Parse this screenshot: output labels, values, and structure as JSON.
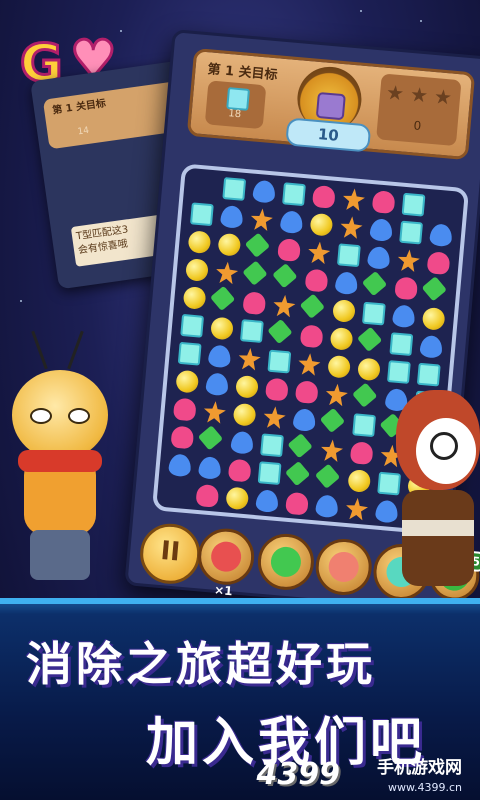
{
  "hud": {
    "level_label": "第 1 关目标",
    "target_count": "18",
    "moves": "10",
    "score": "0"
  },
  "back_card": {
    "level_label": "第 1 关目标",
    "target_count": "14",
    "note": "T型匹配这3\n会有惊喜哦"
  },
  "boosters": {
    "pause_icon": "II",
    "hammer_count": "×1",
    "extra_moves": "+5"
  },
  "slogan": {
    "line1": "消除之旅超好玩",
    "line2": "加入我们吧"
  },
  "watermark": {
    "brand": "4399",
    "site_name": "手机游戏网",
    "url": "www.4399.cn"
  },
  "colors": {
    "accent": "#3fb0f0",
    "hud_wood": "#c88a4e",
    "board_bg": "#1e2350"
  },
  "board": {
    "rows": [
      [
        " ",
        "sq",
        "drop",
        "sq",
        "heart",
        "star",
        "heart",
        "sq",
        " "
      ],
      [
        "sq",
        "drop",
        "star",
        "drop",
        "ball",
        "star",
        "drop",
        "sq",
        "drop"
      ],
      [
        "ball",
        "ball",
        "leaf",
        "heart",
        "star",
        "sq",
        "drop",
        "star",
        "heart"
      ],
      [
        "ball",
        "star",
        "leaf",
        "leaf",
        "heart",
        "drop",
        "leaf",
        "heart",
        "leaf"
      ],
      [
        "ball",
        "leaf",
        "heart",
        "star",
        "leaf",
        "ball",
        "sq",
        "drop",
        "ball"
      ],
      [
        "sq",
        "ball",
        "sq",
        "leaf",
        "heart",
        "ball",
        "leaf",
        "sq",
        "drop"
      ],
      [
        "sq",
        "drop",
        "star",
        "sq",
        "star",
        "ball",
        "ball",
        "sq",
        "sq"
      ],
      [
        "ball",
        "drop",
        "ball",
        "heart",
        "heart",
        "star",
        "leaf",
        "drop",
        "sq"
      ],
      [
        "heart",
        "star",
        "ball",
        "star",
        "drop",
        "leaf",
        "sq",
        "leaf",
        "leaf"
      ],
      [
        "heart",
        "leaf",
        "drop",
        "sq",
        "leaf",
        "star",
        "heart",
        "star",
        "ball"
      ],
      [
        "drop",
        "drop",
        "heart",
        "sq",
        "leaf",
        "leaf",
        "ball",
        "sq",
        "ball"
      ],
      [
        " ",
        "heart",
        "ball",
        "drop",
        "heart",
        "drop",
        "star",
        "drop",
        " "
      ]
    ]
  }
}
